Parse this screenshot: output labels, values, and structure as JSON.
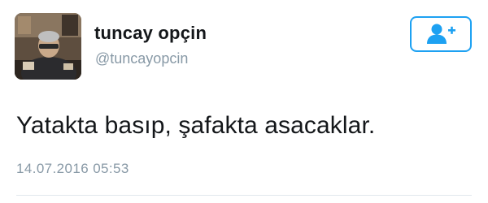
{
  "user": {
    "display_name": "tuncay opçin",
    "handle": "@tuncayopcin",
    "avatar_icon": "profile-photo"
  },
  "actions": {
    "follow_icon": "add-user-icon"
  },
  "tweet": {
    "text": "Yatakta basıp, şafakta asacaklar.",
    "timestamp": "14.07.2016 05:53"
  },
  "colors": {
    "accent": "#1da1f2",
    "text": "#14171a",
    "secondary": "#8899a6"
  }
}
